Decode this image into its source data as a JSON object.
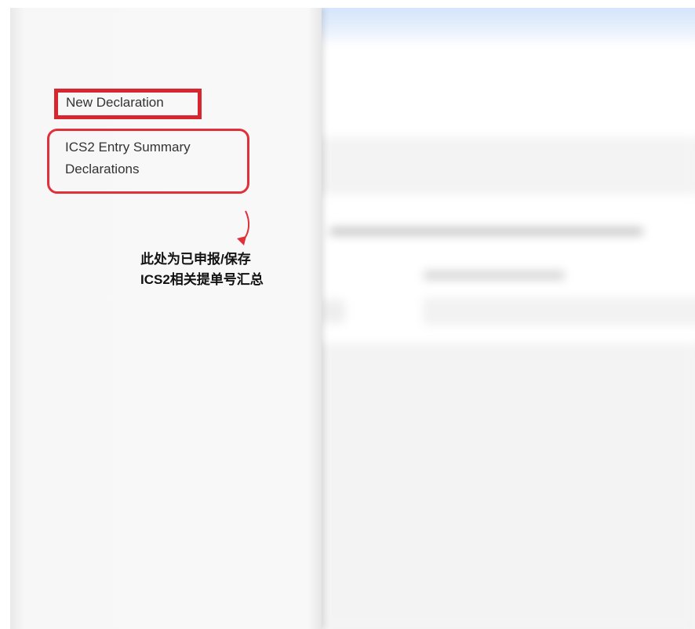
{
  "sidebar": {
    "items": [
      {
        "label": "New Declaration"
      },
      {
        "label": "ICS2 Entry Summary Declarations"
      }
    ]
  },
  "annotation": {
    "line1": "此处为已申报/保存",
    "line2": "ICS2相关提单号汇总",
    "highlight_color": "#d7262f"
  }
}
